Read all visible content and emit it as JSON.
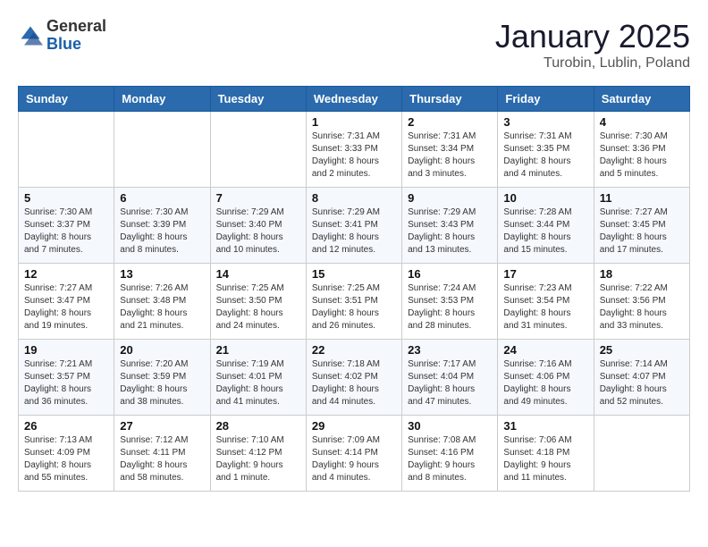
{
  "header": {
    "logo_general": "General",
    "logo_blue": "Blue",
    "month": "January 2025",
    "location": "Turobin, Lublin, Poland"
  },
  "weekdays": [
    "Sunday",
    "Monday",
    "Tuesday",
    "Wednesday",
    "Thursday",
    "Friday",
    "Saturday"
  ],
  "weeks": [
    [
      {
        "day": "",
        "info": ""
      },
      {
        "day": "",
        "info": ""
      },
      {
        "day": "",
        "info": ""
      },
      {
        "day": "1",
        "info": "Sunrise: 7:31 AM\nSunset: 3:33 PM\nDaylight: 8 hours\nand 2 minutes."
      },
      {
        "day": "2",
        "info": "Sunrise: 7:31 AM\nSunset: 3:34 PM\nDaylight: 8 hours\nand 3 minutes."
      },
      {
        "day": "3",
        "info": "Sunrise: 7:31 AM\nSunset: 3:35 PM\nDaylight: 8 hours\nand 4 minutes."
      },
      {
        "day": "4",
        "info": "Sunrise: 7:30 AM\nSunset: 3:36 PM\nDaylight: 8 hours\nand 5 minutes."
      }
    ],
    [
      {
        "day": "5",
        "info": "Sunrise: 7:30 AM\nSunset: 3:37 PM\nDaylight: 8 hours\nand 7 minutes."
      },
      {
        "day": "6",
        "info": "Sunrise: 7:30 AM\nSunset: 3:39 PM\nDaylight: 8 hours\nand 8 minutes."
      },
      {
        "day": "7",
        "info": "Sunrise: 7:29 AM\nSunset: 3:40 PM\nDaylight: 8 hours\nand 10 minutes."
      },
      {
        "day": "8",
        "info": "Sunrise: 7:29 AM\nSunset: 3:41 PM\nDaylight: 8 hours\nand 12 minutes."
      },
      {
        "day": "9",
        "info": "Sunrise: 7:29 AM\nSunset: 3:43 PM\nDaylight: 8 hours\nand 13 minutes."
      },
      {
        "day": "10",
        "info": "Sunrise: 7:28 AM\nSunset: 3:44 PM\nDaylight: 8 hours\nand 15 minutes."
      },
      {
        "day": "11",
        "info": "Sunrise: 7:27 AM\nSunset: 3:45 PM\nDaylight: 8 hours\nand 17 minutes."
      }
    ],
    [
      {
        "day": "12",
        "info": "Sunrise: 7:27 AM\nSunset: 3:47 PM\nDaylight: 8 hours\nand 19 minutes."
      },
      {
        "day": "13",
        "info": "Sunrise: 7:26 AM\nSunset: 3:48 PM\nDaylight: 8 hours\nand 21 minutes."
      },
      {
        "day": "14",
        "info": "Sunrise: 7:25 AM\nSunset: 3:50 PM\nDaylight: 8 hours\nand 24 minutes."
      },
      {
        "day": "15",
        "info": "Sunrise: 7:25 AM\nSunset: 3:51 PM\nDaylight: 8 hours\nand 26 minutes."
      },
      {
        "day": "16",
        "info": "Sunrise: 7:24 AM\nSunset: 3:53 PM\nDaylight: 8 hours\nand 28 minutes."
      },
      {
        "day": "17",
        "info": "Sunrise: 7:23 AM\nSunset: 3:54 PM\nDaylight: 8 hours\nand 31 minutes."
      },
      {
        "day": "18",
        "info": "Sunrise: 7:22 AM\nSunset: 3:56 PM\nDaylight: 8 hours\nand 33 minutes."
      }
    ],
    [
      {
        "day": "19",
        "info": "Sunrise: 7:21 AM\nSunset: 3:57 PM\nDaylight: 8 hours\nand 36 minutes."
      },
      {
        "day": "20",
        "info": "Sunrise: 7:20 AM\nSunset: 3:59 PM\nDaylight: 8 hours\nand 38 minutes."
      },
      {
        "day": "21",
        "info": "Sunrise: 7:19 AM\nSunset: 4:01 PM\nDaylight: 8 hours\nand 41 minutes."
      },
      {
        "day": "22",
        "info": "Sunrise: 7:18 AM\nSunset: 4:02 PM\nDaylight: 8 hours\nand 44 minutes."
      },
      {
        "day": "23",
        "info": "Sunrise: 7:17 AM\nSunset: 4:04 PM\nDaylight: 8 hours\nand 47 minutes."
      },
      {
        "day": "24",
        "info": "Sunrise: 7:16 AM\nSunset: 4:06 PM\nDaylight: 8 hours\nand 49 minutes."
      },
      {
        "day": "25",
        "info": "Sunrise: 7:14 AM\nSunset: 4:07 PM\nDaylight: 8 hours\nand 52 minutes."
      }
    ],
    [
      {
        "day": "26",
        "info": "Sunrise: 7:13 AM\nSunset: 4:09 PM\nDaylight: 8 hours\nand 55 minutes."
      },
      {
        "day": "27",
        "info": "Sunrise: 7:12 AM\nSunset: 4:11 PM\nDaylight: 8 hours\nand 58 minutes."
      },
      {
        "day": "28",
        "info": "Sunrise: 7:10 AM\nSunset: 4:12 PM\nDaylight: 9 hours\nand 1 minute."
      },
      {
        "day": "29",
        "info": "Sunrise: 7:09 AM\nSunset: 4:14 PM\nDaylight: 9 hours\nand 4 minutes."
      },
      {
        "day": "30",
        "info": "Sunrise: 7:08 AM\nSunset: 4:16 PM\nDaylight: 9 hours\nand 8 minutes."
      },
      {
        "day": "31",
        "info": "Sunrise: 7:06 AM\nSunset: 4:18 PM\nDaylight: 9 hours\nand 11 minutes."
      },
      {
        "day": "",
        "info": ""
      }
    ]
  ]
}
